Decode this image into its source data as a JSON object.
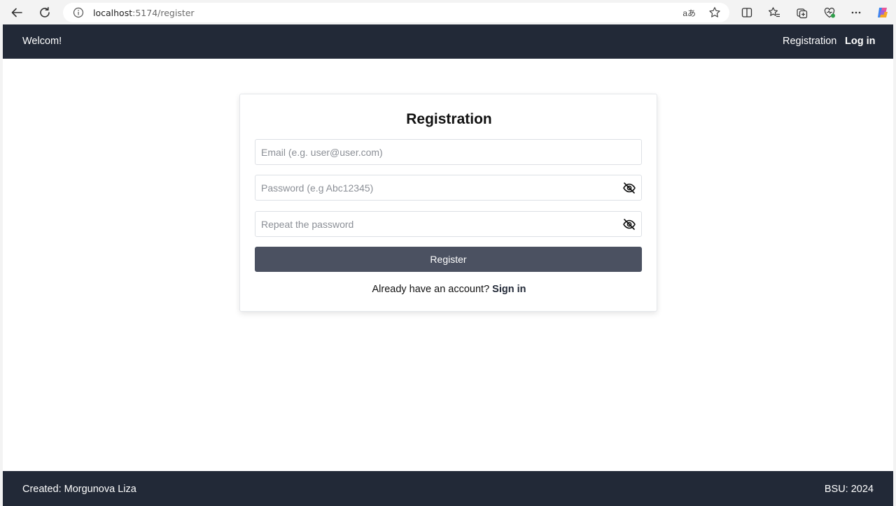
{
  "browser": {
    "url_host": "localhost",
    "url_path": ":5174/register",
    "translate_glyph": "aあ"
  },
  "header": {
    "brand": "Welcom!",
    "nav_registration": "Registration",
    "nav_login": "Log in"
  },
  "form": {
    "title": "Registration",
    "email_placeholder": "Email (e.g. user@user.com)",
    "password_placeholder": "Password (e.g Abc12345)",
    "repeat_placeholder": "Repeat the password",
    "submit_label": "Register",
    "signin_prompt": "Already have an account?",
    "signin_link": "Sign in"
  },
  "footer": {
    "created": "Created: Morgunova Liza",
    "copyright": "BSU: 2024"
  },
  "colors": {
    "header_bg": "#222937",
    "button_bg": "#4b5161"
  },
  "icons": [
    "back-arrow-icon",
    "reload-icon",
    "info-icon",
    "translate-icon",
    "star-icon",
    "split-screen-icon",
    "favorites-icon",
    "collections-icon",
    "browser-essentials-icon",
    "more-icon",
    "copilot-icon",
    "eye-off-icon"
  ]
}
